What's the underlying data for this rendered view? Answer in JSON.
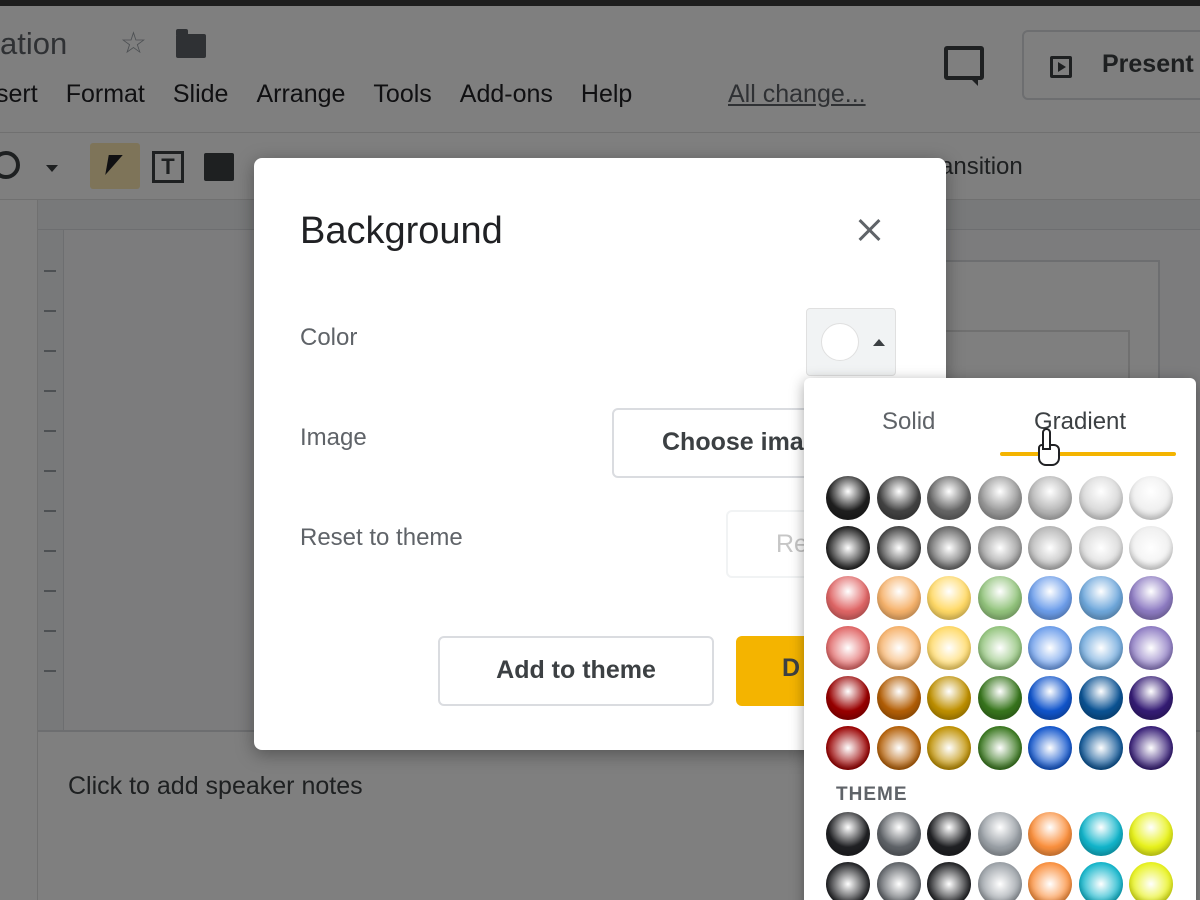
{
  "app": {
    "doc_title": "ation",
    "menu": [
      "sert",
      "Format",
      "Slide",
      "Arrange",
      "Tools",
      "Add-ons",
      "Help"
    ],
    "all_changes": "All change...",
    "present_label": "Present",
    "toolbar_transition": "ansition",
    "notes_placeholder": "Click to add speaker notes"
  },
  "dialog": {
    "title": "Background",
    "color_label": "Color",
    "image_label": "Image",
    "reset_label": "Reset to theme",
    "choose_image_button": "Choose ima",
    "reset_button": "Re",
    "add_to_theme_button": "Add to theme",
    "done_button": "D",
    "selected_color": "#ffffff"
  },
  "picker": {
    "tabs": [
      "Solid",
      "Gradient"
    ],
    "active_tab": "Gradient",
    "theme_label": "THEME",
    "gradient_rows_a": [
      [
        "#1f1f1f",
        "#434343",
        "#666666",
        "#999999",
        "#b7b7b7",
        "#d9d9d9",
        "#efefef"
      ],
      [
        "#1f1f1f",
        "#434343",
        "#666666",
        "#999999",
        "#b7b7b7",
        "#d9d9d9",
        "#efefef"
      ],
      [
        "#e06666",
        "#f6b26b",
        "#ffd966",
        "#93c47d",
        "#6d9eeb",
        "#6fa8dc",
        "#8e7cc3"
      ],
      [
        "#e06666",
        "#f6b26b",
        "#ffd966",
        "#93c47d",
        "#6d9eeb",
        "#6fa8dc",
        "#8e7cc3"
      ],
      [
        "#990000",
        "#b45f06",
        "#bf9000",
        "#38761d",
        "#1155cc",
        "#0b5394",
        "#351c75"
      ],
      [
        "#990000",
        "#b45f06",
        "#bf9000",
        "#38761d",
        "#1155cc",
        "#0b5394",
        "#351c75"
      ]
    ],
    "theme_rows": [
      [
        "#202124",
        "#5f6368",
        "#202124",
        "#9aa0a6",
        "#fa903e",
        "#12b5cb",
        "#e8f21c"
      ],
      [
        "#202124",
        "#5f6368",
        "#202124",
        "#9aa0a6",
        "#fa903e",
        "#12b5cb",
        "#e8f21c"
      ]
    ]
  }
}
